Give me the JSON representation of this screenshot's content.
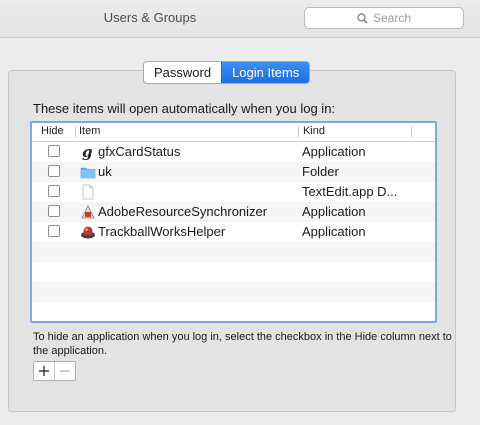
{
  "window": {
    "title": "Users & Groups"
  },
  "search": {
    "placeholder": "Search"
  },
  "tabs": [
    {
      "label": "Password",
      "selected": false
    },
    {
      "label": "Login Items",
      "selected": true
    }
  ],
  "intro_text": "These items will open automatically when you log in:",
  "table": {
    "headers": {
      "hide": "Hide",
      "item": "Item",
      "kind": "Kind"
    },
    "rows": [
      {
        "name": "gfxCardStatus",
        "kind": "Application",
        "icon": "gfxcardstatus-icon",
        "hide": false
      },
      {
        "name": "uk",
        "kind": "Folder",
        "icon": "folder-icon",
        "hide": false
      },
      {
        "name": "",
        "kind": "TextEdit.app D...",
        "icon": "document-icon",
        "hide": false
      },
      {
        "name": "AdobeResourceSynchronizer",
        "kind": "Application",
        "icon": "adobe-app-icon",
        "hide": false
      },
      {
        "name": "TrackballWorksHelper",
        "kind": "Application",
        "icon": "trackball-icon",
        "hide": false
      }
    ]
  },
  "help_text": "To hide an application when you log in, select the checkbox in the Hide column next to the application.",
  "buttons": {
    "add": "+",
    "remove": "−"
  },
  "colors": {
    "accent": "#1c6fe0",
    "focus_ring": "#7aa7e6",
    "folder": "#5fb2f0"
  }
}
